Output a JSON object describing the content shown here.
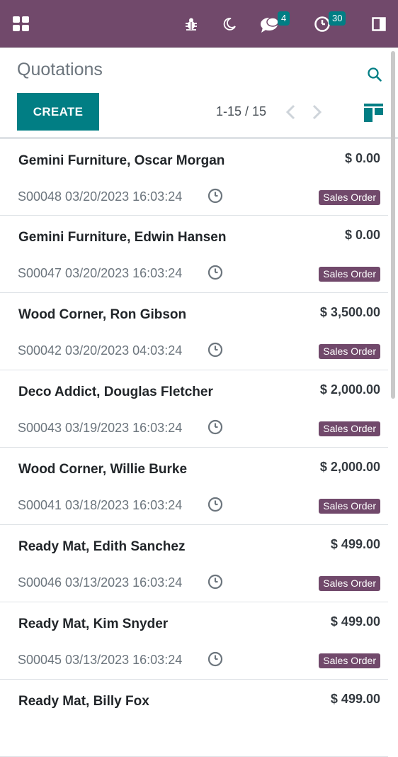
{
  "navbar": {
    "apps_icon": "grid-icon",
    "debug_icon": "bug-icon",
    "theme_icon": "moon-icon",
    "messages_icon": "chat-icon",
    "messages_count": "4",
    "activities_icon": "clock-icon",
    "activities_count": "30",
    "panel_icon": "sidebar-toggle-icon"
  },
  "control": {
    "title": "Quotations",
    "create_label": "CREATE",
    "pager": "1-15 / 15"
  },
  "records": [
    {
      "name": "Gemini Furniture, Oscar Morgan",
      "amount": "$ 0.00",
      "ref": "S00048 03/20/2023 16:03:24",
      "status": "Sales Order"
    },
    {
      "name": "Gemini Furniture, Edwin Hansen",
      "amount": "$ 0.00",
      "ref": "S00047 03/20/2023 16:03:24",
      "status": "Sales Order"
    },
    {
      "name": "Wood Corner, Ron Gibson",
      "amount": "$ 3,500.00",
      "ref": "S00042 03/20/2023 04:03:24",
      "status": "Sales Order"
    },
    {
      "name": "Deco Addict, Douglas Fletcher",
      "amount": "$ 2,000.00",
      "ref": "S00043 03/19/2023 16:03:24",
      "status": "Sales Order"
    },
    {
      "name": "Wood Corner, Willie Burke",
      "amount": "$ 2,000.00",
      "ref": "S00041 03/18/2023 16:03:24",
      "status": "Sales Order"
    },
    {
      "name": "Ready Mat, Edith Sanchez",
      "amount": "$ 499.00",
      "ref": "S00046 03/13/2023 16:03:24",
      "status": "Sales Order"
    },
    {
      "name": "Ready Mat, Kim Snyder",
      "amount": "$ 499.00",
      "ref": "S00045 03/13/2023 16:03:24",
      "status": "Sales Order"
    },
    {
      "name": "Ready Mat, Billy Fox",
      "amount": "$ 499.00",
      "ref": "",
      "status": ""
    }
  ],
  "colors": {
    "brand": "#71496b",
    "accent": "#017e84"
  }
}
